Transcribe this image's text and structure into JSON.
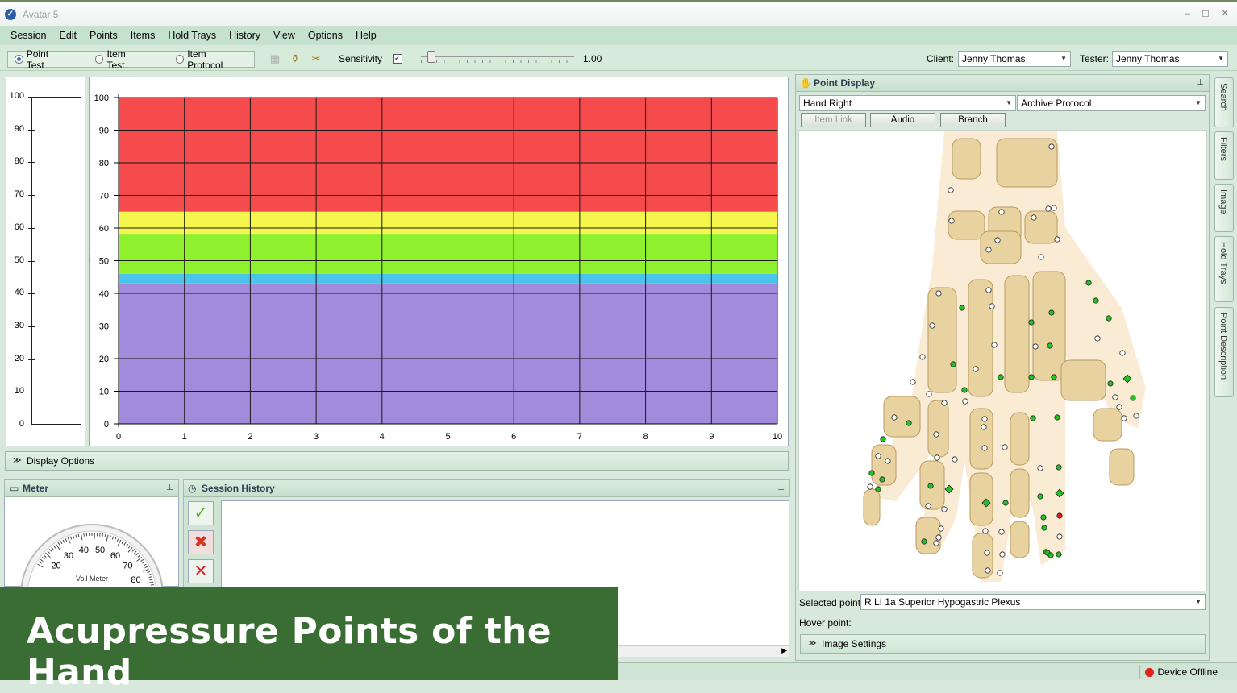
{
  "app": {
    "title": "Avatar 5",
    "window_controls": [
      "–",
      "◻",
      "✕"
    ]
  },
  "menu": [
    "Session",
    "Edit",
    "Points",
    "Items",
    "Hold Trays",
    "History",
    "View",
    "Options",
    "Help"
  ],
  "toolbar": {
    "modes": [
      {
        "label": "Point Test",
        "selected": true
      },
      {
        "label": "Item Test",
        "selected": false
      },
      {
        "label": "Item Protocol",
        "selected": false
      }
    ],
    "sensitivity_label": "Sensitivity",
    "sensitivity_checked": true,
    "sensitivity_value": "1.00",
    "sensitivity_level": 0.04,
    "client_label": "Client:",
    "client_value": "Jenny Thomas",
    "tester_label": "Tester:",
    "tester_value": "Jenny Thomas"
  },
  "meter_scale": {
    "labels": [
      "100",
      "90",
      "80",
      "70",
      "60",
      "50",
      "40",
      "30",
      "20",
      "10",
      "0"
    ]
  },
  "chart_data": {
    "type": "area",
    "x_ticks": [
      "0",
      "1",
      "2",
      "3",
      "4",
      "5",
      "6",
      "7",
      "8",
      "9",
      "10"
    ],
    "y_ticks": [
      "100",
      "90",
      "80",
      "70",
      "60",
      "50",
      "40",
      "30",
      "20",
      "10",
      "0"
    ],
    "xlim": [
      0,
      10
    ],
    "ylim": [
      0,
      100
    ],
    "grid": true,
    "bands": [
      {
        "from": 0,
        "to": 43,
        "color": "#a38bdc"
      },
      {
        "from": 43,
        "to": 46,
        "color": "#4bc4ec"
      },
      {
        "from": 46,
        "to": 58,
        "color": "#8ff12e"
      },
      {
        "from": 58,
        "to": 65,
        "color": "#f4f54d"
      },
      {
        "from": 65,
        "to": 100,
        "color": "#f54b4c"
      }
    ]
  },
  "display_options": "Display Options",
  "meter": {
    "title": "Meter",
    "gauge_labels": [
      "20",
      "30",
      "40",
      "50",
      "60",
      "70",
      "80"
    ],
    "gauge_caption": "Voll Meter"
  },
  "session_history": {
    "title": "Session History"
  },
  "point_display": {
    "title": "Point Display",
    "region_value": "Hand Right",
    "protocol_value": "Archive Protocol",
    "buttons": {
      "item_link": "Item Link",
      "audio": "Audio",
      "branch": "Branch"
    },
    "selected_point_label": "Selected point:",
    "selected_point_value": "R LI 1a Superior Hypogastric Plexus",
    "hover_point_label": "Hover point:",
    "image_settings": "Image Settings"
  },
  "side_tabs": [
    "Search",
    "Filters",
    "Image",
    "Hold Trays",
    "Point Description"
  ],
  "status": {
    "device": "Device Offline",
    "device_color": "#e0241b"
  },
  "banner": {
    "text": "Acupressure Points of the Hand",
    "color": "#3a6d33"
  }
}
